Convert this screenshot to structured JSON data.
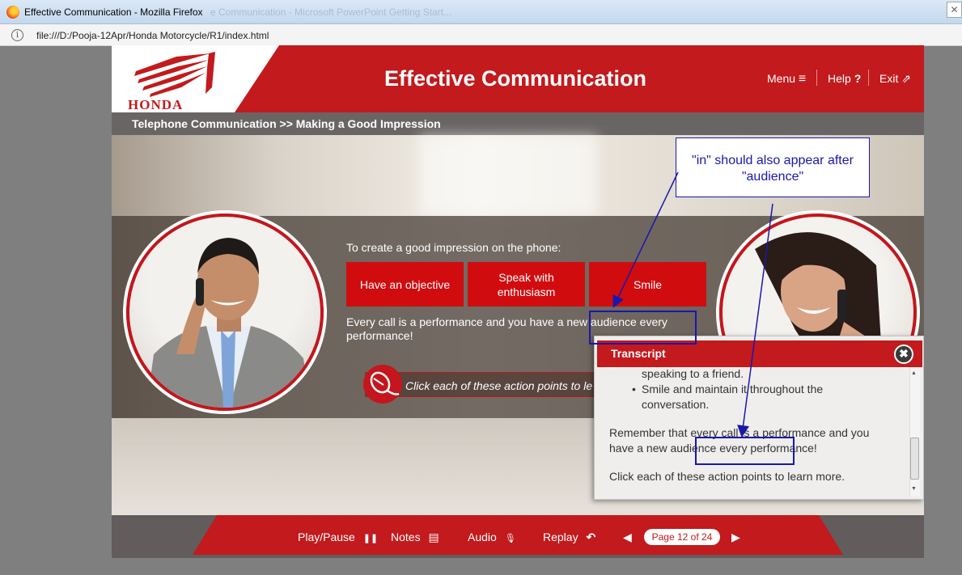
{
  "browser": {
    "window_title": "Effective Communication - Mozilla Firefox",
    "background_tabs": "e Communication - Microsoft PowerPoint     Getting Start...",
    "close_glyph": "✕",
    "url": "file:///D:/Pooja-12Apr/Honda Motorcycle/R1/index.html",
    "info_glyph": "i"
  },
  "header": {
    "logo_text": "HONDA",
    "title": "Effective Communication",
    "menu_label": "Menu",
    "menu_glyph": "≡",
    "help_label": "Help",
    "help_glyph": "?",
    "exit_label": "Exit",
    "exit_glyph": "⇗"
  },
  "breadcrumb": "Telephone Communication >> Making a Good Impression",
  "content": {
    "intro": "To create a good impression on the phone:",
    "action_buttons": [
      "Have an objective",
      "Speak with enthusiasm",
      "Smile"
    ],
    "performance_text": "Every call is a performance and you have a new audience every performance!",
    "click_prompt": "Click each of these action points to le"
  },
  "transcript": {
    "title": "Transcript",
    "close_glyph": "✖",
    "bullet_partial": "speaking to a friend.",
    "bullet_item": "Smile and maintain it throughout the conversation.",
    "paragraph_1": "Remember that every call is a performance and you have a new audience every performance!",
    "paragraph_2": "Click each of these action points to learn more.",
    "scroll_up": "▲",
    "scroll_down": "▼"
  },
  "footer": {
    "play_pause_label": "Play/Pause",
    "play_pause_glyph": "❚❚",
    "notes_label": "Notes",
    "notes_glyph": "▤",
    "audio_label": "Audio",
    "audio_glyph": "🎙",
    "replay_label": "Replay",
    "replay_glyph": "↶",
    "prev_glyph": "◀",
    "page_indicator": "Page 12 of 24",
    "next_glyph": "▶"
  },
  "review_note": {
    "text": "\"in\" should also appear after \"audience\"",
    "color": "#1a17ae"
  },
  "colors": {
    "brand_red": "#c21a1d",
    "button_red": "#d10c0f",
    "footer_gray": "#625c5c",
    "annotation_blue": "#1a17ae"
  }
}
